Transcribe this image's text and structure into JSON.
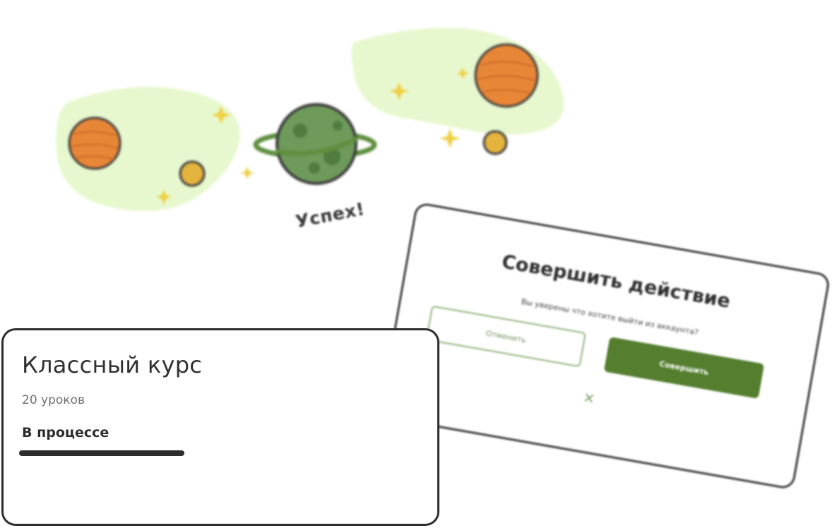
{
  "illustration": {
    "success_text": "Успех!",
    "colors": {
      "blob": "#e7f8cf",
      "orange_planet": "#e88638",
      "green_planet": "#6e9a5a",
      "gold_moon": "#e3b33e",
      "stars": "#eed046",
      "outline": "#3a3a3a"
    }
  },
  "modal": {
    "title": "Совершить действие",
    "message": "Вы уверены что хотите выйти из аккаунта?",
    "cancel_label": "Отменить",
    "confirm_label": "Совершить",
    "close_icon": "×",
    "colors": {
      "accent": "#557e2f",
      "cancel_border": "#8fb37a"
    }
  },
  "course_card": {
    "title": "Классный курс",
    "lessons": "20 уроков",
    "status": "В процессе",
    "progress": 0.41
  }
}
